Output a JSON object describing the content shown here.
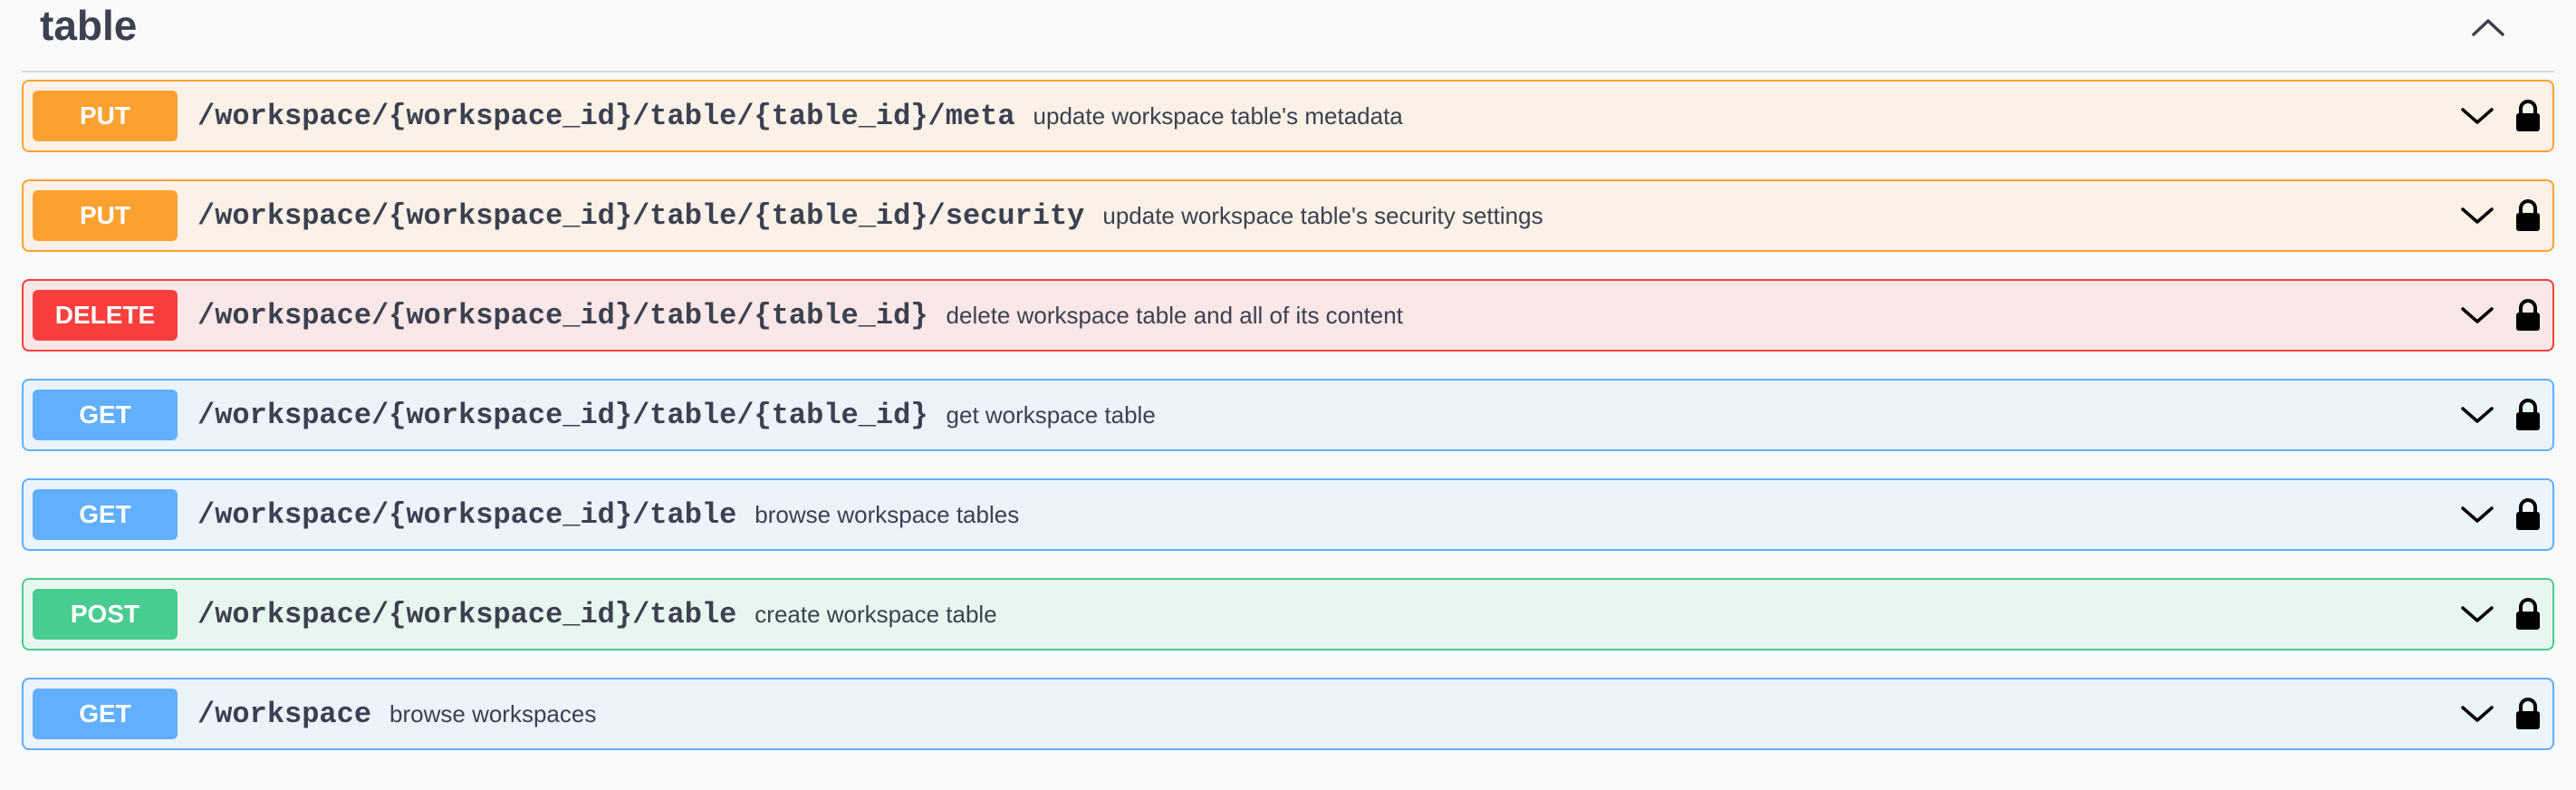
{
  "section": {
    "title": "table",
    "toggle_icon": "chevron-up-icon"
  },
  "colors": {
    "put": "#fca130",
    "delete": "#f93e3e",
    "get": "#61affe",
    "post": "#49cc90",
    "text": "#3b4151"
  },
  "operations": [
    {
      "method": "PUT",
      "path": "/workspace/{workspace_id}/table/{table_id}/meta",
      "summary": "update workspace table's metadata"
    },
    {
      "method": "PUT",
      "path": "/workspace/{workspace_id}/table/{table_id}/security",
      "summary": "update workspace table's security settings"
    },
    {
      "method": "DELETE",
      "path": "/workspace/{workspace_id}/table/{table_id}",
      "summary": "delete workspace table and all of its content"
    },
    {
      "method": "GET",
      "path": "/workspace/{workspace_id}/table/{table_id}",
      "summary": "get workspace table"
    },
    {
      "method": "GET",
      "path": "/workspace/{workspace_id}/table",
      "summary": "browse workspace tables"
    },
    {
      "method": "POST",
      "path": "/workspace/{workspace_id}/table",
      "summary": "create workspace table"
    },
    {
      "method": "GET",
      "path": "/workspace",
      "summary": "browse workspaces"
    }
  ],
  "icons": {
    "expand": "chevron-down-icon",
    "auth": "lock-icon"
  }
}
